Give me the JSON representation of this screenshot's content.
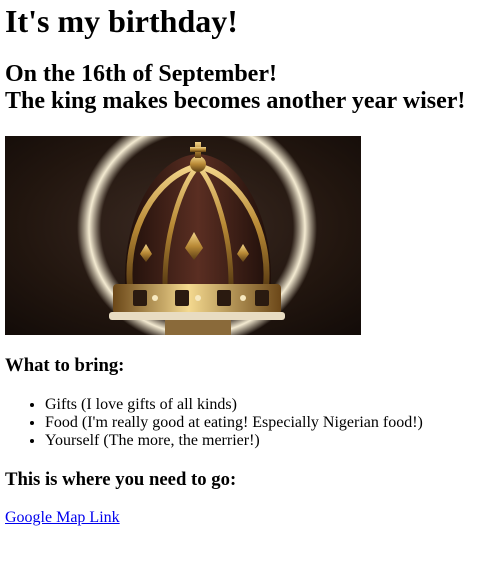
{
  "heading": {
    "title": "It's my birthday!",
    "date_line": "On the 16th of September!",
    "tagline": "The king makes becomes another year wiser!"
  },
  "hero_image": {
    "subject": "crown-image",
    "alt": "",
    "colors": {
      "background": "#1a1210",
      "glow": "#f3ead0",
      "gold": "#c9a24a",
      "velvet": "#3a1c14"
    }
  },
  "bring": {
    "heading": "What to bring:",
    "items": [
      "Gifts (I love gifts of all kinds)",
      "Food (I'm really good at eating! Especially Nigerian food!)",
      "Yourself (The more, the merrier!)"
    ]
  },
  "location": {
    "heading": "This is where you need to go:",
    "link_text": "Google Map Link",
    "link_color": "#0000ee"
  }
}
